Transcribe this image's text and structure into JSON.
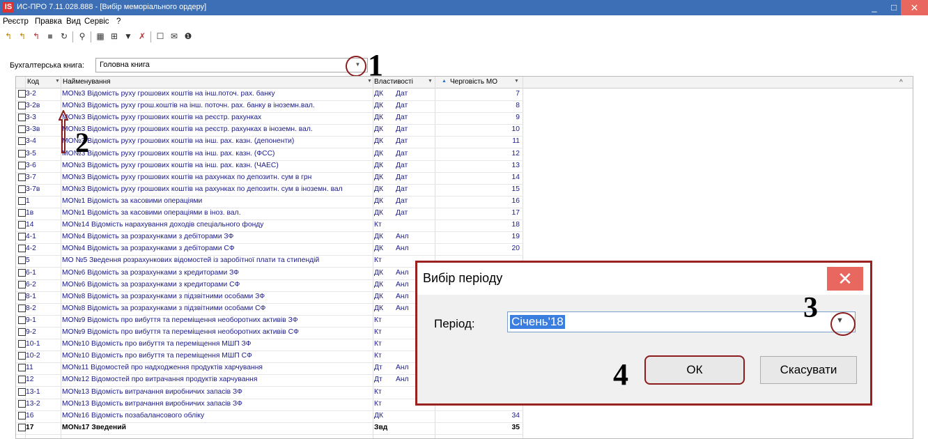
{
  "window": {
    "logo": "IS",
    "title": "ИС-ПРО 7.11.028.888 - [Вибір меморіального ордеру]",
    "minimize": "_",
    "maximize": "□",
    "close": "✕"
  },
  "menu": [
    "Реєстр",
    "Правка",
    "Вид",
    "Сервіс",
    "?"
  ],
  "toolbar_icons": [
    "new-doc-icon",
    "new-copy-icon",
    "new-delete-icon",
    "doc-icon",
    "refresh-icon",
    "search-icon",
    "table-icon",
    "tree-icon",
    "filter-icon",
    "clear-filter-icon",
    "form-icon",
    "mail-icon",
    "help-icon"
  ],
  "toolbar_glyphs": [
    "↰",
    "↰",
    "↰",
    "■",
    "↻",
    "⚲",
    "▦",
    "⊞",
    "▼",
    "✗",
    "☐",
    "✉",
    "❶"
  ],
  "book": {
    "label": "Бухгалтерська книга:",
    "value": "Головна книга",
    "dropdown": "▼"
  },
  "grid": {
    "headers": {
      "code": "Код",
      "name": "Найменування",
      "props": "Властивості",
      "order": "Черговість МО"
    },
    "rows": [
      {
        "code": "3-2",
        "name": "МО№3 Відомість руху грошових коштів на інш.поточ. рах. банку",
        "p1": "ДК",
        "p2": "Дат",
        "order": "7"
      },
      {
        "code": "3-2в",
        "name": "МО№3 Відомість руху грош.коштів на інш. поточн. рах. банку в іноземн.вал.",
        "p1": "ДК",
        "p2": "Дат",
        "order": "8"
      },
      {
        "code": "3-3",
        "name": "МО№3 Відомість руху грошових коштів на реєстр. рахунках",
        "p1": "ДК",
        "p2": "Дат",
        "order": "9"
      },
      {
        "code": "3-3в",
        "name": "МО№3 Відомість руху грошових коштів на реєстр. рахунках в іноземн. вал.",
        "p1": "ДК",
        "p2": "Дат",
        "order": "10"
      },
      {
        "code": "3-4",
        "name": "МО№3 Відомість руху грошових коштів на інш. рах. казн. (депоненти)",
        "p1": "ДК",
        "p2": "Дат",
        "order": "11"
      },
      {
        "code": "3-5",
        "name": "МО№3 Відомість руху грошових коштів на інш. рах. казн. (ФСС)",
        "p1": "ДК",
        "p2": "Дат",
        "order": "12"
      },
      {
        "code": "3-6",
        "name": "МО№3 Відомість руху грошових коштів на інш. рах. казн. (ЧАЕС)",
        "p1": "ДК",
        "p2": "Дат",
        "order": "13"
      },
      {
        "code": "3-7",
        "name": "МО№3 Відомість руху грошових коштів на рахунках по депозитн. сум в грн",
        "p1": "ДК",
        "p2": "Дат",
        "order": "14"
      },
      {
        "code": "3-7в",
        "name": "МО№3 Відомість руху грошових коштів на рахунках по депозитн. сум в іноземн. вал",
        "p1": "ДК",
        "p2": "Дат",
        "order": "15"
      },
      {
        "code": "1",
        "name": "МО№1 Відомість за касовими операціями",
        "p1": "ДК",
        "p2": "Дат",
        "order": "16"
      },
      {
        "code": "1в",
        "name": "МО№1 Відомість за касовими операціями в іноз. вал.",
        "p1": "ДК",
        "p2": "Дат",
        "order": "17"
      },
      {
        "code": "14",
        "name": "МО№14 Відомість нарахування доходів спеціального фонду",
        "p1": "Кт",
        "p2": "",
        "order": "18"
      },
      {
        "code": "4-1",
        "name": "МО№4 Відомість за розрахунками з дебіторами ЗФ",
        "p1": "ДК",
        "p2": "Анл",
        "order": "19"
      },
      {
        "code": "4-2",
        "name": "МО№4 Відомість за розрахунками з дебіторами СФ",
        "p1": "ДК",
        "p2": "Анл",
        "order": "20"
      },
      {
        "code": "5",
        "name": "МО №5 Зведення розрахункових відомостей із заробітної плати та стипендій",
        "p1": "Кт",
        "p2": "",
        "order": ""
      },
      {
        "code": "6-1",
        "name": "МО№6 Відомість за розрахунками з кредиторами ЗФ",
        "p1": "ДК",
        "p2": "Анл",
        "order": ""
      },
      {
        "code": "6-2",
        "name": "МО№6 Відомість за розрахунками з кредиторами СФ",
        "p1": "ДК",
        "p2": "Анл",
        "order": ""
      },
      {
        "code": "8-1",
        "name": "МО№8 Відомість за розрахунками з підзвітними особами ЗФ",
        "p1": "ДК",
        "p2": "Анл",
        "order": ""
      },
      {
        "code": "8-2",
        "name": "МО№8 Відомість за розрахунками з підзвітними особами СФ",
        "p1": "ДК",
        "p2": "Анл",
        "order": ""
      },
      {
        "code": "9-1",
        "name": "МО№9 Відомість про вибуття та переміщення необоротних активів ЗФ",
        "p1": "Кт",
        "p2": "",
        "order": ""
      },
      {
        "code": "9-2",
        "name": "МО№9 Відомість про вибуття та переміщення необоротних активів СФ",
        "p1": "Кт",
        "p2": "",
        "order": ""
      },
      {
        "code": "10-1",
        "name": "МО№10 Відомість про вибуття та переміщення МШП ЗФ",
        "p1": "Кт",
        "p2": "",
        "order": ""
      },
      {
        "code": "10-2",
        "name": "МО№10 Відомість про вибуття та переміщення МШП СФ",
        "p1": "Кт",
        "p2": "",
        "order": ""
      },
      {
        "code": "11",
        "name": "МО№11 Відомостей про надходження продуктів харчування",
        "p1": "Дт",
        "p2": "Анл",
        "order": ""
      },
      {
        "code": "12",
        "name": "МО№12 Відомостей про витрачання продуктів харчування",
        "p1": "Дт",
        "p2": "Анл",
        "order": ""
      },
      {
        "code": "13-1",
        "name": "МО№13 Відомість витрачання виробничих запасів ЗФ",
        "p1": "Кт",
        "p2": "",
        "order": ""
      },
      {
        "code": "13-2",
        "name": "МО№13 Відомість витрачання виробничих запасів ЗФ",
        "p1": "Кт",
        "p2": "",
        "order": "33"
      },
      {
        "code": "16",
        "name": "МО№16 Відомість позабалансового обліку",
        "p1": "ДК",
        "p2": "",
        "order": "34"
      },
      {
        "code": "17",
        "name": "МО№17 Зведений",
        "p1": "Звд",
        "p2": "",
        "order": "35"
      }
    ]
  },
  "dialog": {
    "title": "Вибір періоду",
    "close": "✕",
    "period_label": "Період:",
    "period_value": "Січень'18",
    "dropdown": "▼",
    "ok": "ОК",
    "cancel": "Скасувати"
  },
  "annotations": {
    "n1": "1",
    "n2": "2",
    "n3": "3",
    "n4": "4"
  },
  "scroll_up": "^"
}
